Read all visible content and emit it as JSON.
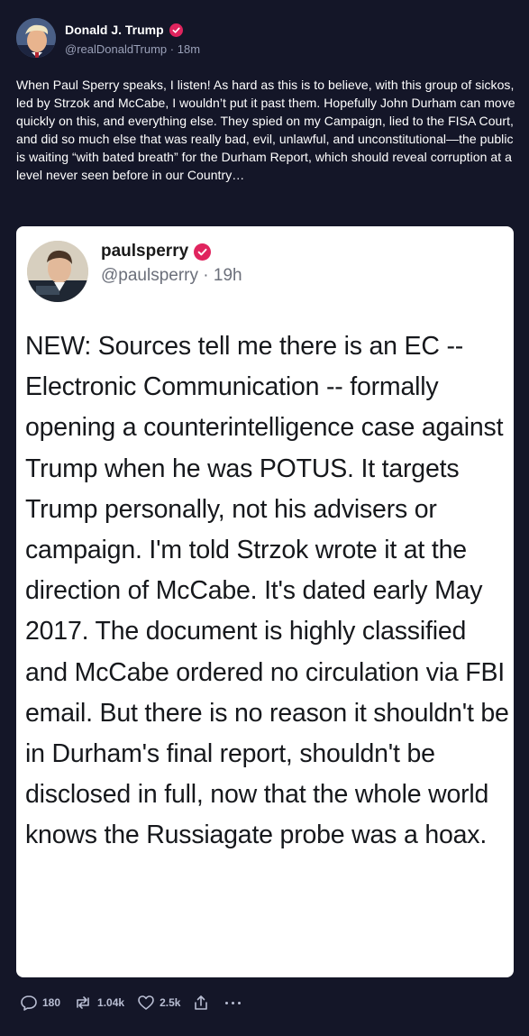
{
  "post": {
    "author": {
      "name": "Donald J. Trump",
      "handle": "@realDonaldTrump",
      "separator": "·",
      "time": "18m"
    },
    "text": "When Paul Sperry speaks, I listen! As hard as this is to believe, with this group of sickos, led by Strzok and McCabe, I wouldn’t put it past them. Hopefully John Durham can move quickly on this, and everything else. They spied on my Campaign, lied to the FISA Court, and did so much else that was really bad, evil, unlawful, and unconstitutional—the public is waiting “with bated breath” for the Durham Report, which should reveal corruption at a level never seen before in our Country…"
  },
  "quoted": {
    "author": {
      "name": "paulsperry",
      "handle": "@paulsperry",
      "separator": "·",
      "time": "19h"
    },
    "text": "NEW: Sources tell me there is an EC -- Electronic Communication -- formally opening a counterintelligence case against Trump when he was POTUS. It targets Trump personally, not his advisers or campaign. I'm told Strzok wrote it at the direction of McCabe. It's dated early May 2017. The document is highly classified and McCabe ordered no circulation via FBI email. But there is no reason it shouldn't be in Durham's final report, shouldn't be disclosed in full, now that the whole world knows the Russiagate probe was a hoax."
  },
  "actions": {
    "replies": "180",
    "retruths": "1.04k",
    "likes": "2.5k"
  },
  "icons": {
    "verified": "verified-badge-icon",
    "reply": "reply-icon",
    "retruth": "retruth-icon",
    "like": "heart-icon",
    "share": "share-icon",
    "more": "more-icon"
  },
  "colors": {
    "background": "#141628",
    "verified": "#e0245e",
    "muted": "#9aa0b8"
  }
}
